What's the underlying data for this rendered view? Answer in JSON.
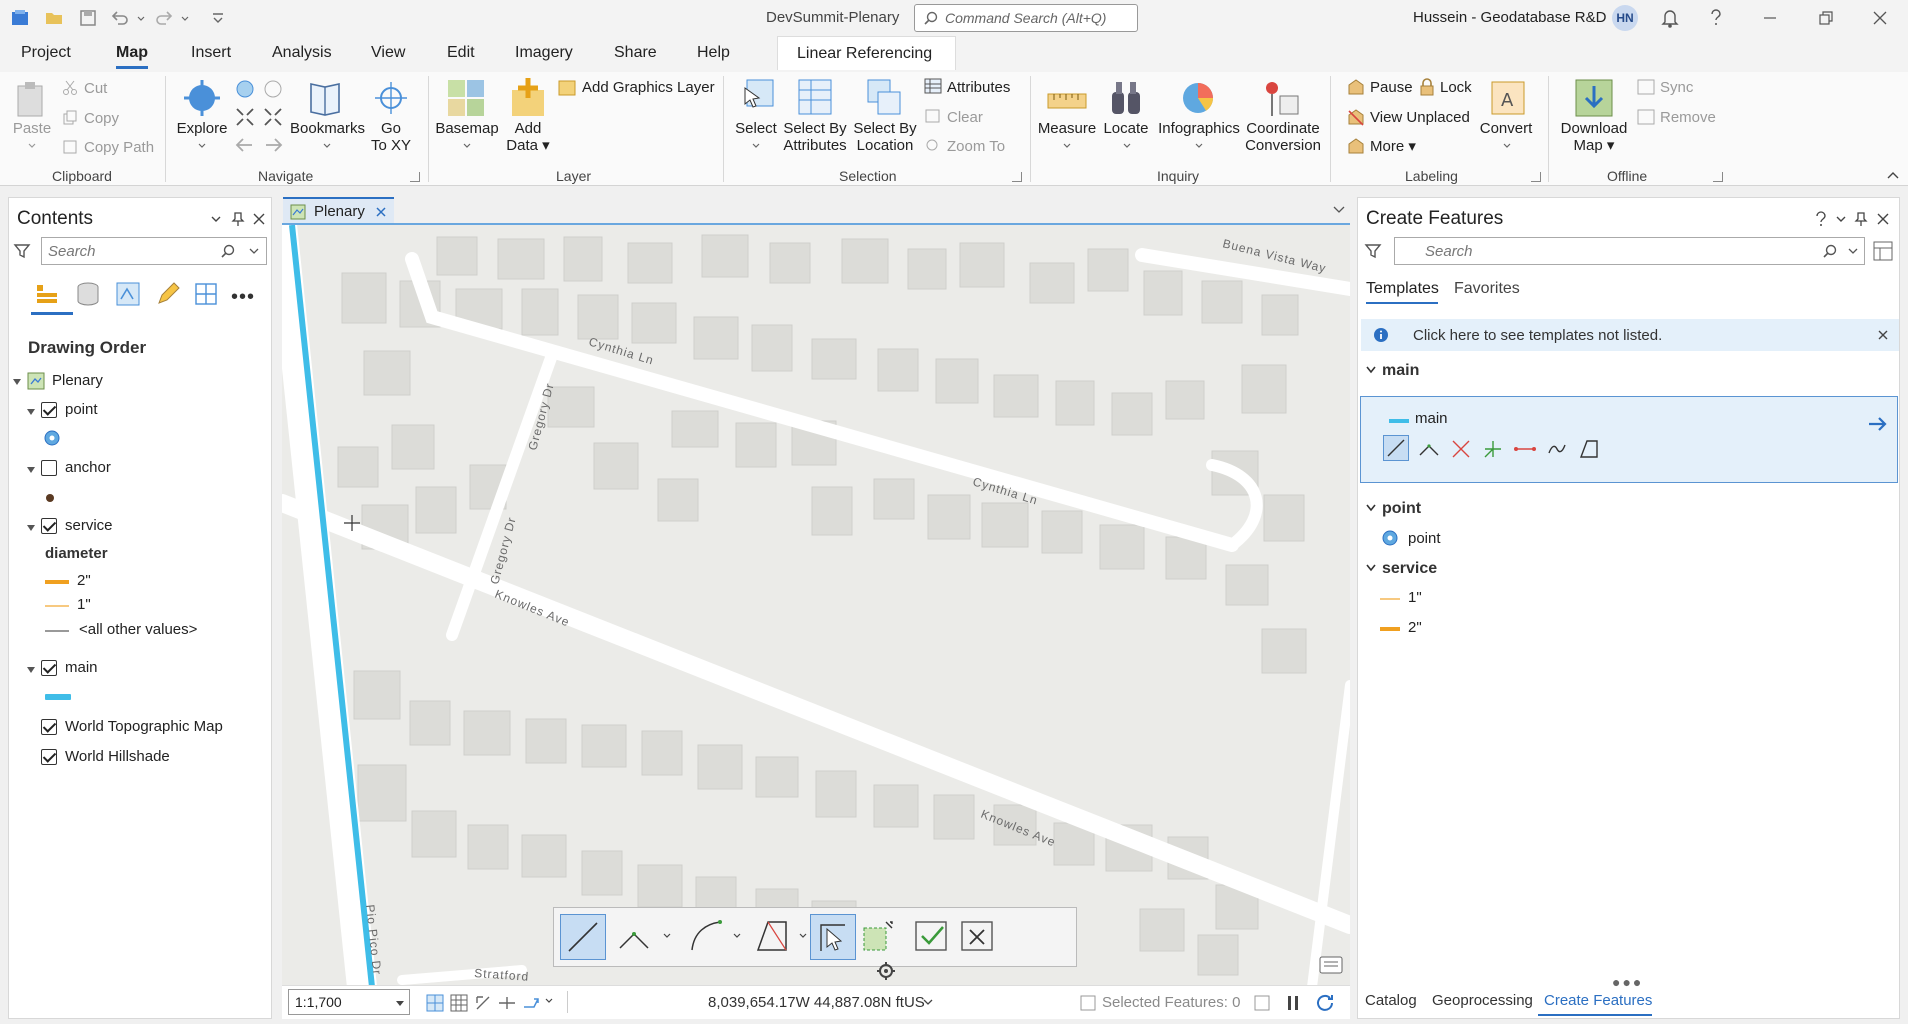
{
  "app": {
    "title": "DevSummit-Plenary",
    "command_search_placeholder": "Command Search (Alt+Q)",
    "user": "Hussein - Geodatabase R&D",
    "user_initials": "HN"
  },
  "menu": {
    "tabs": [
      "Project",
      "Map",
      "Insert",
      "Analysis",
      "View",
      "Edit",
      "Imagery",
      "Share",
      "Help"
    ],
    "contextual_tab": "Linear Referencing"
  },
  "ribbon": {
    "clipboard": {
      "label": "Clipboard",
      "paste": "Paste",
      "cut": "Cut",
      "copy": "Copy",
      "copy_path": "Copy Path"
    },
    "navigate": {
      "label": "Navigate",
      "explore": "Explore",
      "bookmarks": "Bookmarks",
      "go_to_xy": [
        "Go",
        "To XY"
      ]
    },
    "layer": {
      "label": "Layer",
      "basemap": "Basemap",
      "add_data": [
        "Add",
        "Data"
      ],
      "add_graphics_layer": "Add Graphics Layer"
    },
    "selection": {
      "label": "Selection",
      "select": "Select",
      "select_by_attributes": [
        "Select By",
        "Attributes"
      ],
      "select_by_location": [
        "Select By",
        "Location"
      ],
      "attributes": "Attributes",
      "clear": "Clear",
      "zoom_to": "Zoom To"
    },
    "inquiry": {
      "label": "Inquiry",
      "measure": "Measure",
      "locate": "Locate",
      "infographics": "Infographics",
      "coordinate_conversion": [
        "Coordinate",
        "Conversion"
      ]
    },
    "labeling": {
      "label": "Labeling",
      "pause": "Pause",
      "lock": "Lock",
      "view_unplaced": "View Unplaced",
      "more": "More",
      "convert": "Convert"
    },
    "offline": {
      "label": "Offline",
      "download_map": [
        "Download",
        "Map"
      ],
      "sync": "Sync",
      "remove": "Remove"
    }
  },
  "contents": {
    "title": "Contents",
    "search_placeholder": "Search",
    "section": "Drawing Order",
    "map_name": "Plenary",
    "layers": {
      "point": "point",
      "anchor": "anchor",
      "service": "service",
      "service_field": "diameter",
      "service_classes": [
        "2\"",
        "1\"",
        "<all other values>"
      ],
      "main": "main",
      "topo": "World Topographic Map",
      "hillshade": "World Hillshade"
    }
  },
  "map": {
    "tab_label": "Plenary",
    "street_labels": [
      "Buena Vista Way",
      "Cynthia Ln",
      "Cynthia Ln",
      "Gregory Dr",
      "Gregory Dr",
      "Knowles Ave",
      "Knowles Ave",
      "Stratford",
      "Pio Pico Dr"
    ],
    "scale": "1:1,700",
    "coordinates": "8,039,654.17W 44,887.08N ftUS",
    "selected_features": "Selected Features: 0"
  },
  "create_features": {
    "title": "Create Features",
    "search_placeholder": "Search",
    "tabs": [
      "Templates",
      "Favorites"
    ],
    "hint": "Click here to see templates not listed.",
    "groups": {
      "main": "main",
      "main_template": "main",
      "point": "point",
      "point_template": "point",
      "service": "service",
      "service_templates": [
        "1\"",
        "2\""
      ]
    }
  },
  "bottom_tabs": [
    "Catalog",
    "Geoprocessing",
    "Create Features"
  ],
  "colors": {
    "accent": "#2b6fc2",
    "main_line": "#3fbde8",
    "service_2in": "#f0a020",
    "service_1in": "#f7c980",
    "map_bg": "#ebebe8",
    "road": "#ffffff",
    "building": "#dcdcd8"
  }
}
